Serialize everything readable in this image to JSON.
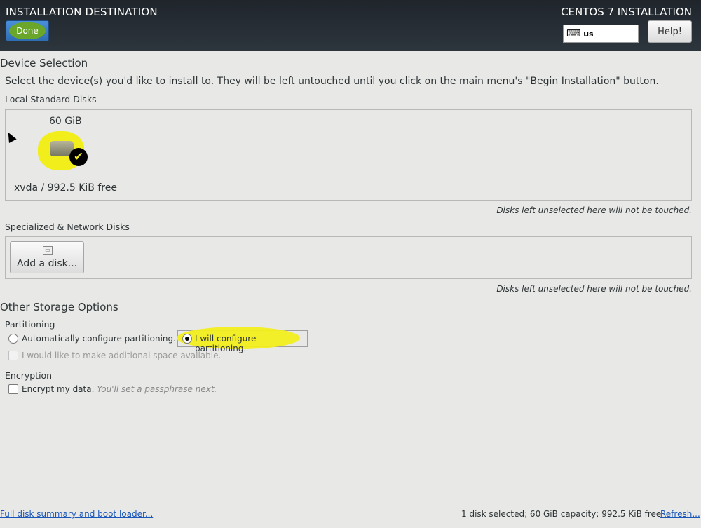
{
  "header": {
    "spoke_title": "INSTALLATION DESTINATION",
    "done_label": "Done",
    "product_title": "CENTOS 7 INSTALLATION",
    "keyboard_layout": "us",
    "help_label": "Help!"
  },
  "device_selection": {
    "title": "Device Selection",
    "instructions": "Select the device(s) you'd like to install to.  They will be left untouched until you click on the main menu's \"Begin Installation\" button.",
    "local_disks": {
      "title": "Local Standard Disks",
      "disks": [
        {
          "size": "60 GiB",
          "name": "xvda",
          "separator": "/",
          "free": "992.5 KiB free",
          "selected": true
        }
      ],
      "note": "Disks left unselected here will not be touched."
    },
    "network_disks": {
      "title": "Specialized & Network Disks",
      "add_label": "Add a disk...",
      "note": "Disks left unselected here will not be touched."
    }
  },
  "storage_options": {
    "title": "Other Storage Options",
    "partitioning": {
      "title": "Partitioning",
      "auto_label": "Automatically configure partitioning.",
      "manual_label": "I will configure partitioning.",
      "selected": "manual",
      "reclaim_label": "I would like to make additional space available."
    },
    "encryption": {
      "title": "Encryption",
      "encrypt_label": "Encrypt my data.",
      "encrypt_hint": "You'll set a passphrase next."
    }
  },
  "footer": {
    "summary_link": "Full disk summary and boot loader...",
    "status": "1 disk selected; 60 GiB capacity; 992.5 KiB free",
    "refresh_link": "Refresh..."
  },
  "colors": {
    "header_bg": "#2d353d",
    "highlight": "#f2ee1c",
    "done_highlight": "#6aa62a",
    "link": "#1a57b8"
  }
}
